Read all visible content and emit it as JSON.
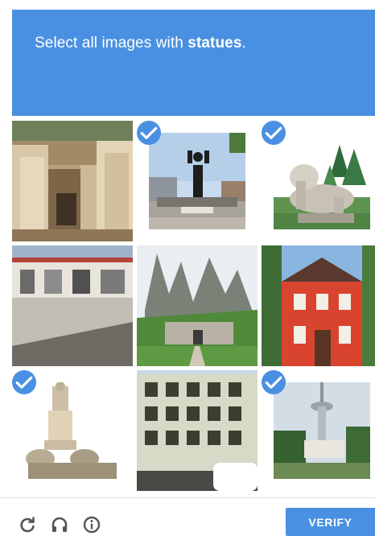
{
  "header": {
    "prompt_prefix": "Select all images with ",
    "prompt_keyword": "statues",
    "prompt_suffix": "."
  },
  "tiles": [
    {
      "name": "tile-stone-ruins",
      "selected": false
    },
    {
      "name": "tile-statue-on-pedestal",
      "selected": true
    },
    {
      "name": "tile-lion-statue",
      "selected": true
    },
    {
      "name": "tile-garage-building",
      "selected": false
    },
    {
      "name": "tile-rock-fortress",
      "selected": false
    },
    {
      "name": "tile-red-house",
      "selected": false
    },
    {
      "name": "tile-monument-sculpture",
      "selected": true
    },
    {
      "name": "tile-apartment-building",
      "selected": false
    },
    {
      "name": "tile-tv-tower",
      "selected": true
    }
  ],
  "footer": {
    "icons": [
      "reload-icon",
      "audio-icon",
      "info-icon"
    ],
    "verify_label": "VERIFY"
  },
  "colors": {
    "accent": "#4a90e2"
  }
}
